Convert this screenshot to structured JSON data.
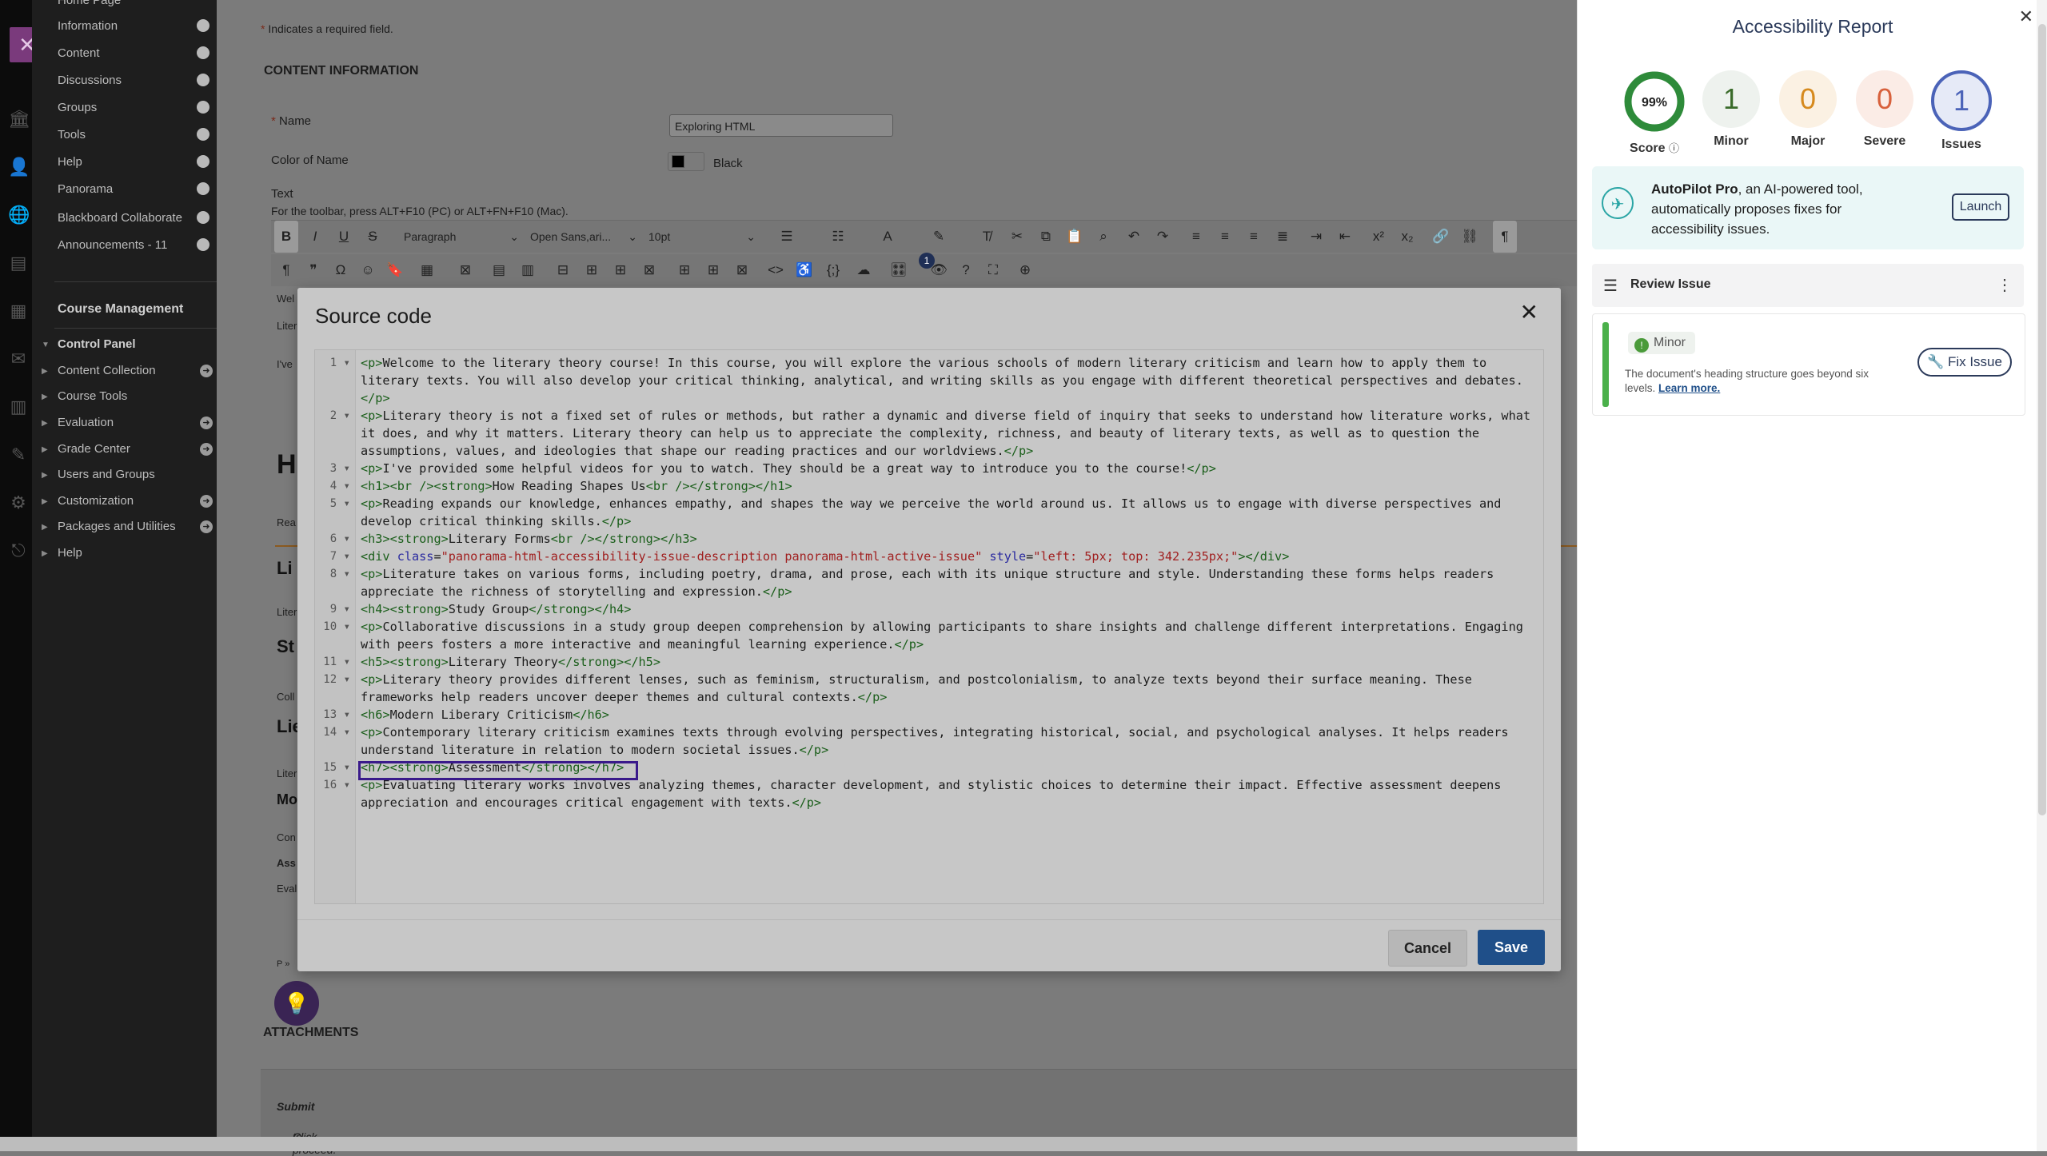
{
  "required_note": "Indicates a required field.",
  "content_info_heading": "CONTENT INFORMATION",
  "name_label": "Name",
  "name_value": "Exploring HTML",
  "color_label": "Color of Name",
  "color_value": "Black",
  "text_label": "Text",
  "toolbar_hint": "For the toolbar, press ALT+F10 (PC) or ALT+FN+F10 (Mac).",
  "toolbar": {
    "block_format": "Paragraph",
    "font_family": "Open Sans,ari...",
    "font_size": "10pt",
    "badge_count": "1"
  },
  "course_menu": {
    "items": [
      "Home Page",
      "Information",
      "Content",
      "Discussions",
      "Groups",
      "Tools",
      "Help",
      "Panorama",
      "Blackboard Collaborate",
      "Announcements - 11"
    ],
    "management_heading": "Course Management",
    "control_panel_heading": "Control Panel",
    "control_panel_items": [
      "Content Collection",
      "Course Tools",
      "Evaluation",
      "Grade Center",
      "Users and Groups",
      "Customization",
      "Packages and Utilities",
      "Help"
    ]
  },
  "background_fragments": [
    "Wel",
    "Liter",
    "I've",
    "H",
    "Rea",
    "Li",
    "Liter",
    "St",
    "Coll",
    "Lie",
    "Liter",
    "Mo",
    "Con",
    "Ass",
    "Eval",
    "P »"
  ],
  "attachments_heading": "ATTACHMENTS",
  "submit_hint_pre": "Click ",
  "submit_hint_bold": "Submit",
  "submit_hint_post": " to proceed.",
  "modal": {
    "title": "Source code",
    "cancel_label": "Cancel",
    "save_label": "Save",
    "code_lines": [
      {
        "n": "1",
        "text": "<p>Welcome to the literary theory course! In this course, you will explore the various schools of modern literary criticism and learn how to apply them to literary texts. You will also develop your critical thinking, analytical, and writing skills as you engage with different theoretical perspectives and debates.</p>"
      },
      {
        "n": "2",
        "text": "<p>Literary theory is not a fixed set of rules or methods, but rather a dynamic and diverse field of inquiry that seeks to understand how literature works, what it does, and why it matters. Literary theory can help us to appreciate the complexity, richness, and beauty of literary texts, as well as to question the assumptions, values, and ideologies that shape our reading practices and our worldviews.</p>"
      },
      {
        "n": "3",
        "text": "<p>I've provided some helpful videos for you to watch. They should be a great way to introduce you to the course!</p>"
      },
      {
        "n": "4",
        "text": "<h1><br /><strong>How Reading Shapes Us<br /></strong></h1>"
      },
      {
        "n": "5",
        "text": "<p>Reading expands our knowledge, enhances empathy, and shapes the way we perceive the world around us. It allows us to engage with diverse perspectives and develop critical thinking skills.</p>"
      },
      {
        "n": "6",
        "text": "<h3><strong>Literary Forms<br /></strong></h3>"
      },
      {
        "n": "7",
        "text": "<div class=\"panorama-html-accessibility-issue-description panorama-html-active-issue\" style=\"left: 5px; top: 342.235px;\"></div>"
      },
      {
        "n": "8",
        "text": "<p>Literature takes on various forms, including poetry, drama, and prose, each with its unique structure and style. Understanding these forms helps readers appreciate the richness of storytelling and expression.</p>"
      },
      {
        "n": "9",
        "text": "<h4><strong>Study Group</strong></h4>"
      },
      {
        "n": "10",
        "text": "<p>Collaborative discussions in a study group deepen comprehension by allowing participants to share insights and challenge different interpretations. Engaging with peers fosters a more interactive and meaningful learning experience.</p>"
      },
      {
        "n": "11",
        "text": "<h5><strong>Literary Theory</strong></h5>"
      },
      {
        "n": "12",
        "text": "<p>Literary theory provides different lenses, such as feminism, structuralism, and postcolonialism, to analyze texts beyond their surface meaning. These frameworks help readers uncover deeper themes and cultural contexts.</p>"
      },
      {
        "n": "13",
        "text": "<h6>Modern Liberary Criticism</h6>"
      },
      {
        "n": "14",
        "text": "<p>Contemporary literary criticism examines texts through evolving perspectives, integrating historical, social, and psychological analyses. It helps readers understand literature in relation to modern societal issues.</p>"
      },
      {
        "n": "15",
        "text": "<h7><strong>Assessment</strong></h7>"
      },
      {
        "n": "16",
        "text": "<p>Evaluating literary works involves analyzing themes, character development, and stylistic choices to determine their impact. Effective assessment deepens appreciation and encourages critical engagement with texts.</p>"
      }
    ]
  },
  "report": {
    "title": "Accessibility Report",
    "score_value": "99%",
    "score_label": "Score",
    "minor_value": "1",
    "minor_label": "Minor",
    "major_value": "0",
    "major_label": "Major",
    "severe_value": "0",
    "severe_label": "Severe",
    "issues_value": "1",
    "issues_label": "Issues",
    "score_fraction": 0.99,
    "autopilot_name": "AutoPilot Pro",
    "autopilot_text": ", an AI-powered tool, automatically proposes fixes for accessibility issues.",
    "launch_label": "Launch",
    "review_label": "Review Issue",
    "issue_severity": "Minor",
    "issue_description": "The document's heading structure goes beyond six levels.",
    "learn_more_label": "Learn more.",
    "fix_label": "Fix Issue",
    "colors": {
      "score_ring": "#2e8b3a",
      "minor": "#3a6b2a",
      "major": "#d68a1e",
      "severe": "#d8613c",
      "issues": "#4b63b8",
      "accent_navy": "#2b3a5a"
    }
  }
}
